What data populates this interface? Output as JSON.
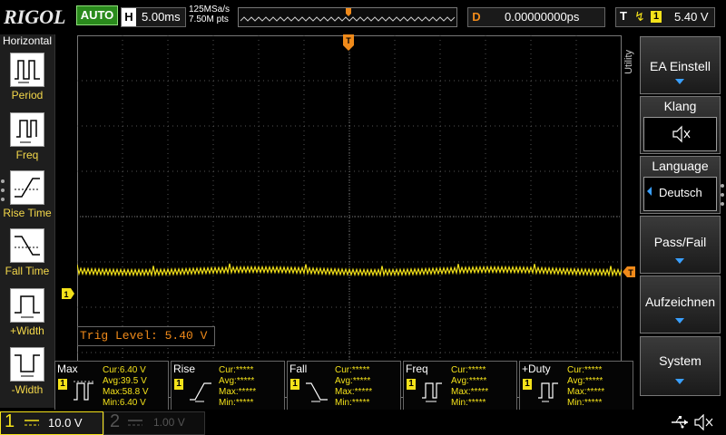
{
  "brand": "RIGOL",
  "run_mode": "AUTO",
  "timebase": {
    "label": "H",
    "value": "5.00ms"
  },
  "sampling": {
    "rate": "125MSa/s",
    "points": "7.50M pts"
  },
  "delay": {
    "label": "D",
    "value": "0.00000000ps"
  },
  "trigger": {
    "label": "T",
    "edge_icon": "rising-edge",
    "source": "1",
    "level": "5.40 V",
    "level_text": "Trig Level: 5.40 V"
  },
  "left_panel": {
    "title": "Horizontal",
    "items": [
      {
        "label": "Period",
        "icon": "period-icon"
      },
      {
        "label": "Freq",
        "icon": "freq-icon"
      },
      {
        "label": "Rise Time",
        "icon": "rise-time-icon"
      },
      {
        "label": "Fall Time",
        "icon": "fall-time-icon"
      },
      {
        "label": "+Width",
        "icon": "plus-width-icon"
      },
      {
        "label": "-Width",
        "icon": "minus-width-icon"
      }
    ]
  },
  "right_menu": {
    "side_label": "Utility",
    "items": [
      {
        "label": "EA Einstell"
      },
      {
        "label": "Klang",
        "value": "mute"
      },
      {
        "label": "Language",
        "value": "Deutsch"
      },
      {
        "label": "Pass/Fail"
      },
      {
        "label": "Aufzeichnen"
      },
      {
        "label": "System"
      }
    ]
  },
  "measurements": [
    {
      "name": "Max",
      "ch": "1",
      "cur": "Cur:6.40 V",
      "avg": "Avg:39.5 V",
      "max": "Max:58.8 V",
      "min": "Min:6.40 V"
    },
    {
      "name": "Rise",
      "ch": "1",
      "cur": "Cur:*****",
      "avg": "Avg:*****",
      "max": "Max:*****",
      "min": "Min:*****"
    },
    {
      "name": "Fall",
      "ch": "1",
      "cur": "Cur:*****",
      "avg": "Avg:*****",
      "max": "Max:*****",
      "min": "Min:*****"
    },
    {
      "name": "Freq",
      "ch": "1",
      "cur": "Cur:*****",
      "avg": "Avg:*****",
      "max": "Max:*****",
      "min": "Min:*****"
    },
    {
      "name": "+Duty",
      "ch": "1",
      "cur": "Cur:*****",
      "avg": "Avg:*****",
      "max": "Max:*****",
      "min": "Min:*****"
    }
  ],
  "channels": [
    {
      "num": "1",
      "scale": "10.0 V",
      "active": true
    },
    {
      "num": "2",
      "scale": "1.00 V",
      "active": false
    }
  ],
  "markers": {
    "ch1": "1",
    "trigger": "T"
  },
  "colors": {
    "ch1": "#f4e21a",
    "trigger": "#f08a1a",
    "accent": "#3aa0ff",
    "auto": "#2a8a1c"
  }
}
